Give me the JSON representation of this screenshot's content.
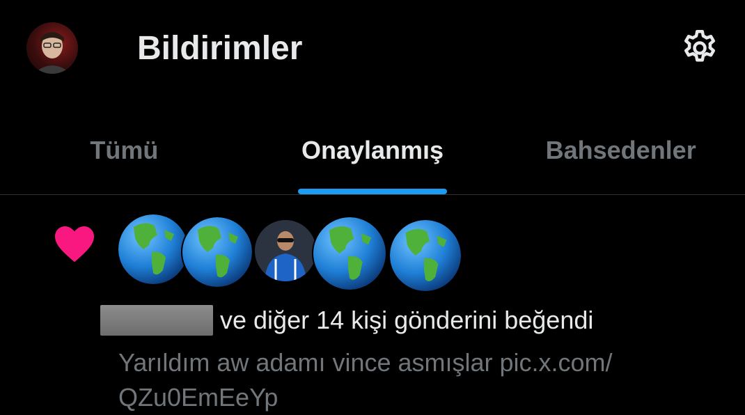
{
  "header": {
    "title": "Bildirimler"
  },
  "tabs": [
    {
      "label": "Tümü",
      "active": false
    },
    {
      "label": "Onaylanmış",
      "active": true
    },
    {
      "label": "Bahsedenler",
      "active": false
    }
  ],
  "notification": {
    "icon": "heart-icon",
    "icon_color": "#f91880",
    "text": "ve diğer 14 kişi gönderini beğendi",
    "post_text": "Yarıldım aw adamı vince asmışlar pic.x.com/ QZu0EmEeYp"
  },
  "colors": {
    "accent": "#1d9bf0",
    "like": "#f91880",
    "muted": "#71767b"
  }
}
